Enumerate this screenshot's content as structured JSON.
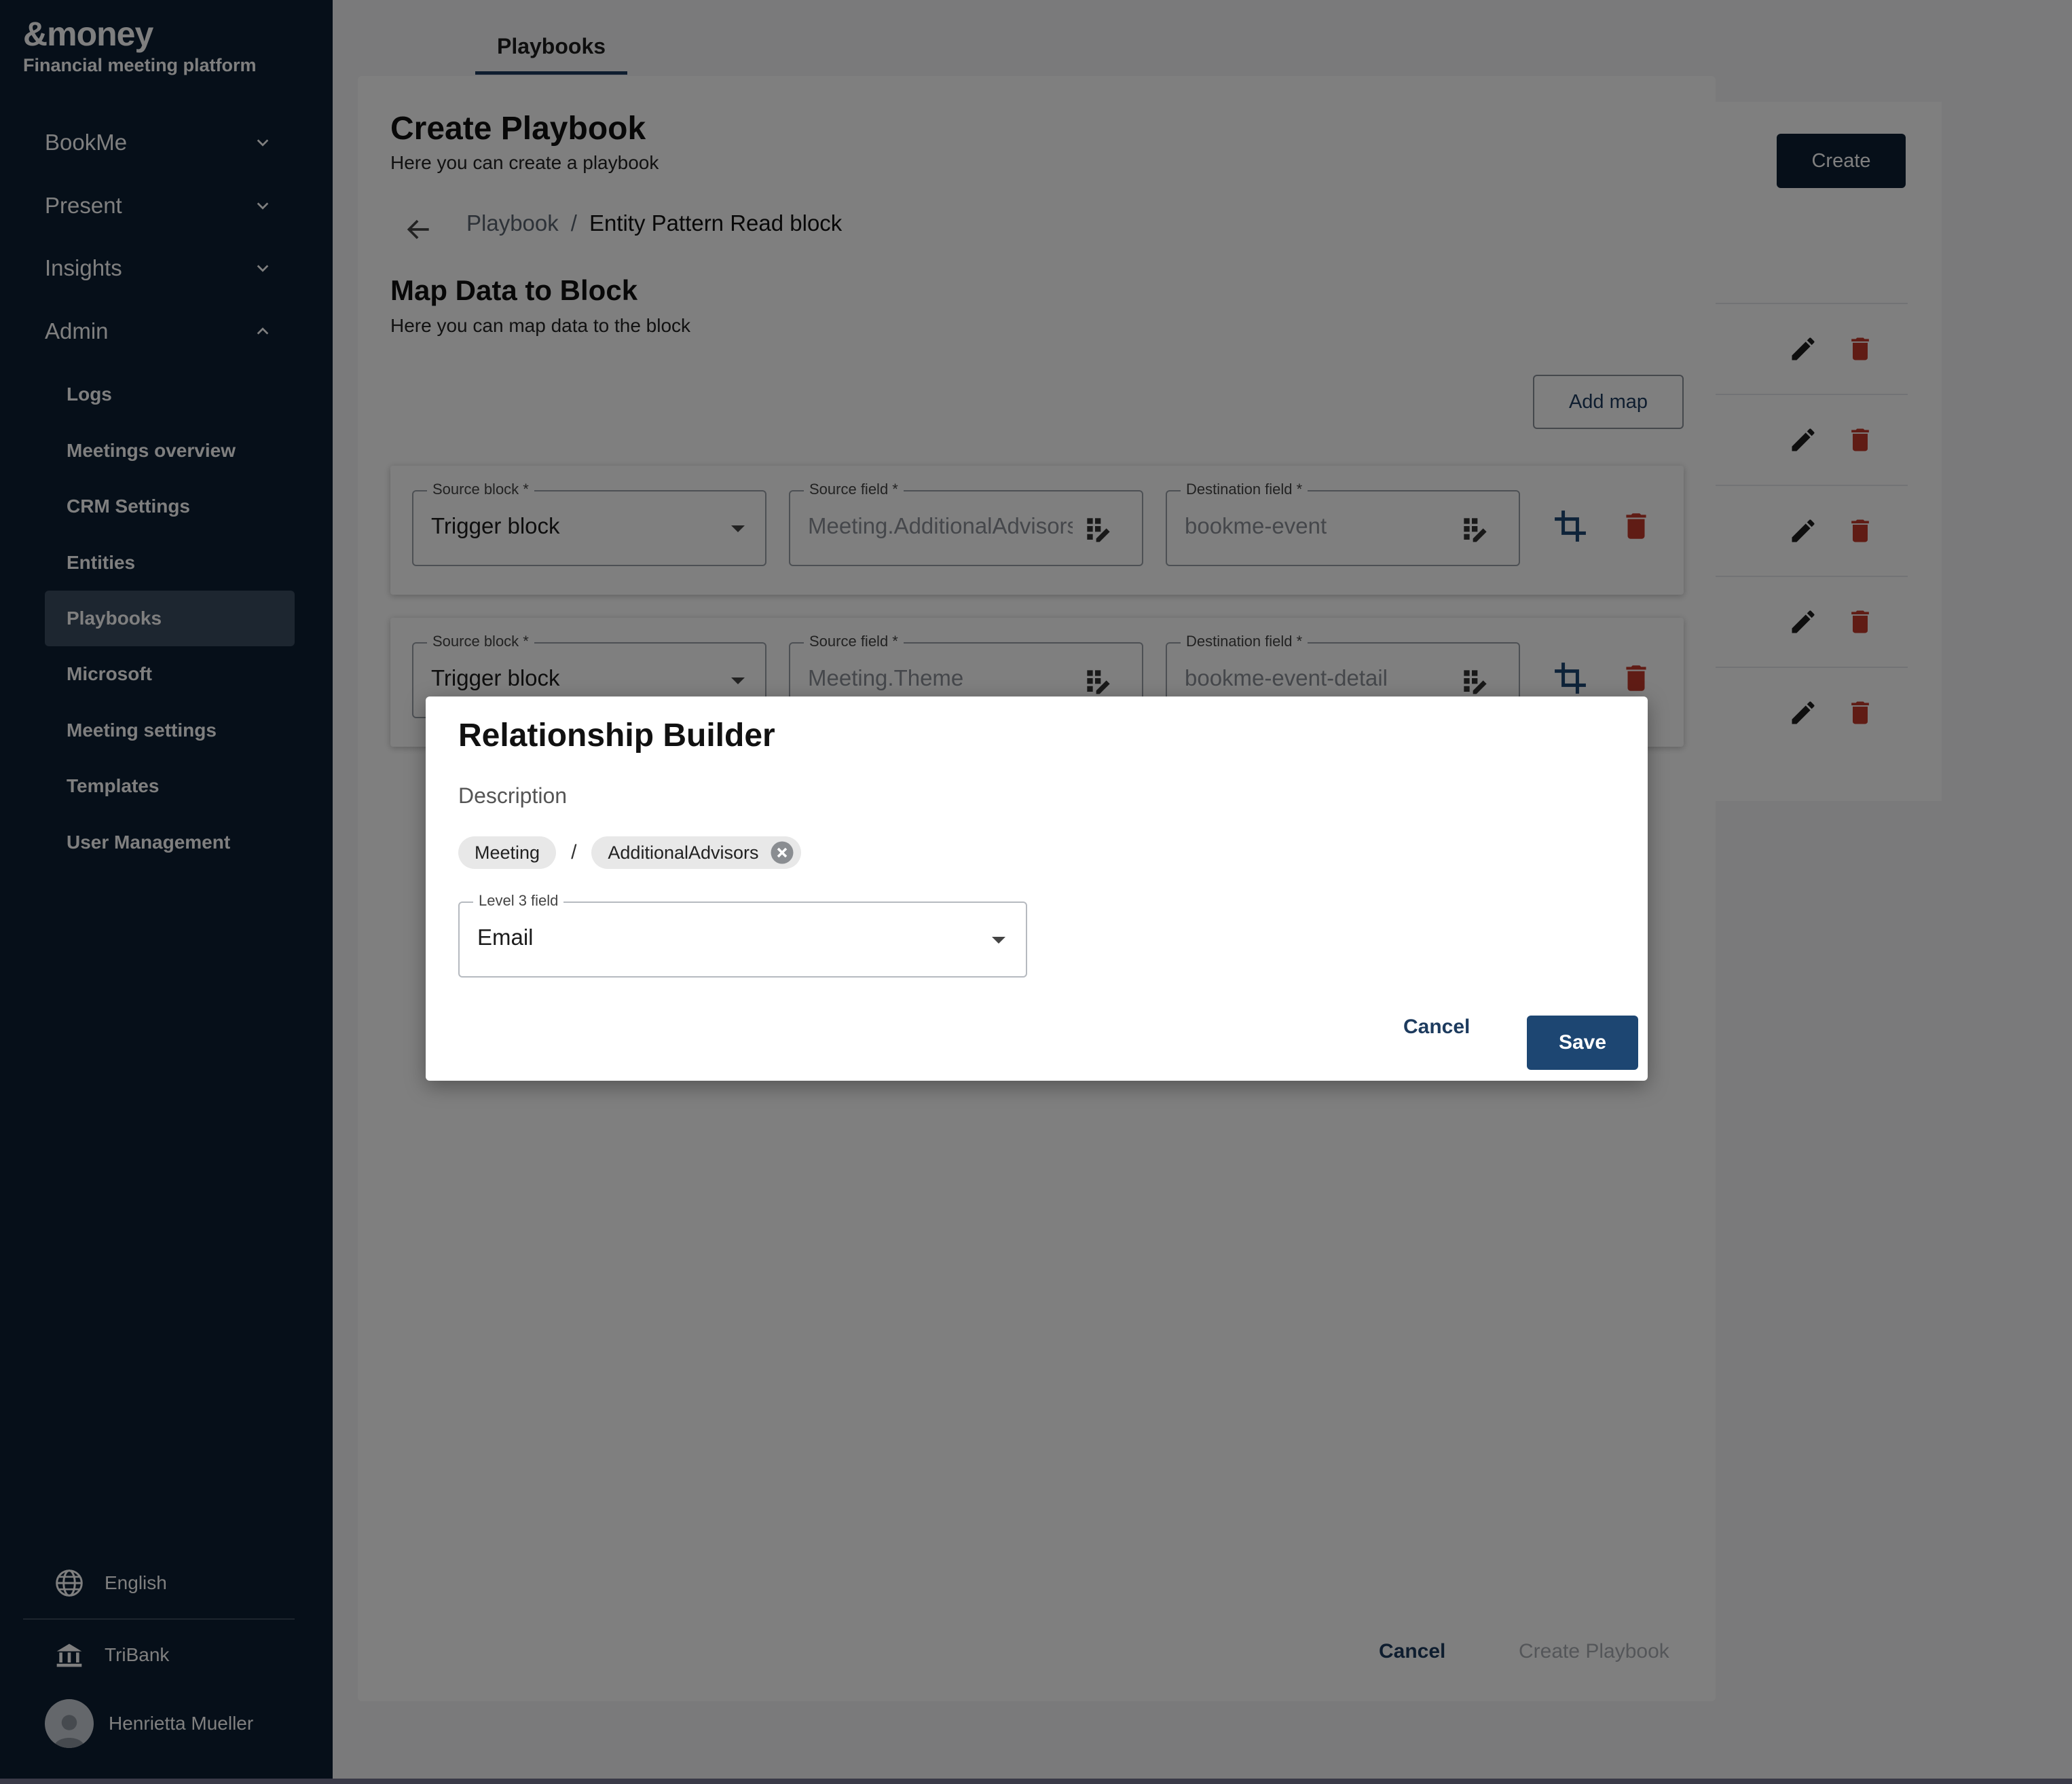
{
  "brand": {
    "logo": "&money",
    "tagline": "Financial meeting platform"
  },
  "sidebar": {
    "groups": [
      {
        "label": "BookMe"
      },
      {
        "label": "Present"
      },
      {
        "label": "Insights"
      },
      {
        "label": "Admin"
      }
    ],
    "admin_items": [
      {
        "label": "Logs"
      },
      {
        "label": "Meetings overview"
      },
      {
        "label": "CRM Settings"
      },
      {
        "label": "Entities"
      },
      {
        "label": "Playbooks"
      },
      {
        "label": "Microsoft"
      },
      {
        "label": "Meeting settings"
      },
      {
        "label": "Templates"
      },
      {
        "label": "User Management"
      }
    ],
    "active_item": "Playbooks",
    "footer": {
      "language": "English",
      "bank": "TriBank",
      "user": "Henrietta Mueller"
    }
  },
  "page": {
    "tab": "Playbooks",
    "create_label": "Create"
  },
  "create_dialog": {
    "title": "Create Playbook",
    "subtitle": "Here you can create a playbook",
    "breadcrumb": {
      "parent": "Playbook",
      "separator": "/",
      "current": "Entity Pattern Read block"
    },
    "section_title": "Map Data to Block",
    "section_subtitle": "Here you can map data to the block",
    "add_map_label": "Add map",
    "maps": [
      {
        "source_block_label": "Source block *",
        "source_block_value": "Trigger block",
        "source_field_label": "Source field *",
        "source_field_value": "Meeting.AdditionalAdvisors",
        "destination_field_label": "Destination field *",
        "destination_field_value": "bookme-event"
      },
      {
        "source_block_label": "Source block *",
        "source_block_value": "Trigger block",
        "source_field_label": "Source field *",
        "source_field_value": "Meeting.Theme",
        "destination_field_label": "Destination field *",
        "destination_field_value": "bookme-event-detail"
      }
    ],
    "cancel_label": "Cancel",
    "create_label": "Create Playbook"
  },
  "relationship_builder": {
    "title": "Relationship Builder",
    "description_label": "Description",
    "path": [
      "Meeting",
      "AdditionalAdvisors"
    ],
    "path_separator": "/",
    "level_field_label": "Level 3 field",
    "level_field_value": "Email",
    "cancel_label": "Cancel",
    "save_label": "Save"
  },
  "colors": {
    "sidebar_bg": "#0d1f33",
    "primary": "#1d4672",
    "danger": "#c0392b",
    "active_item_bg": "#3a4c60"
  }
}
